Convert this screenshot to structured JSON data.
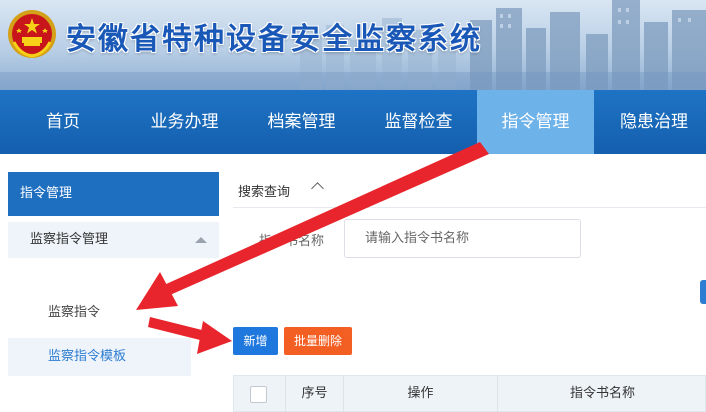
{
  "header": {
    "title": "安徽省特种设备安全监察系统",
    "emblem_icon": "national-emblem-icon"
  },
  "nav": {
    "items": [
      {
        "label": "首页"
      },
      {
        "label": "业务办理"
      },
      {
        "label": "档案管理"
      },
      {
        "label": "监督检查"
      },
      {
        "label": "指令管理",
        "active": true
      },
      {
        "label": "隐患治理"
      }
    ]
  },
  "sidebar": {
    "header": "指令管理",
    "group": {
      "title": "监察指令管理",
      "items": [
        {
          "label": "监察指令"
        },
        {
          "label": "监察指令模板",
          "selected": true
        }
      ]
    }
  },
  "search": {
    "title": "搜索查询",
    "field_label": "指令书名称",
    "placeholder": "请输入指令书名称",
    "value": ""
  },
  "toolbar": {
    "add_label": "新增",
    "batch_delete_label": "批量删除"
  },
  "table": {
    "columns": [
      "",
      "序号",
      "操作",
      "指令书名称"
    ]
  },
  "colors": {
    "nav_bg": "#1f73c4",
    "nav_active": "#6eb2ea",
    "primary": "#1e78dd",
    "danger": "#f35e22",
    "arrow": "#e8252c"
  }
}
